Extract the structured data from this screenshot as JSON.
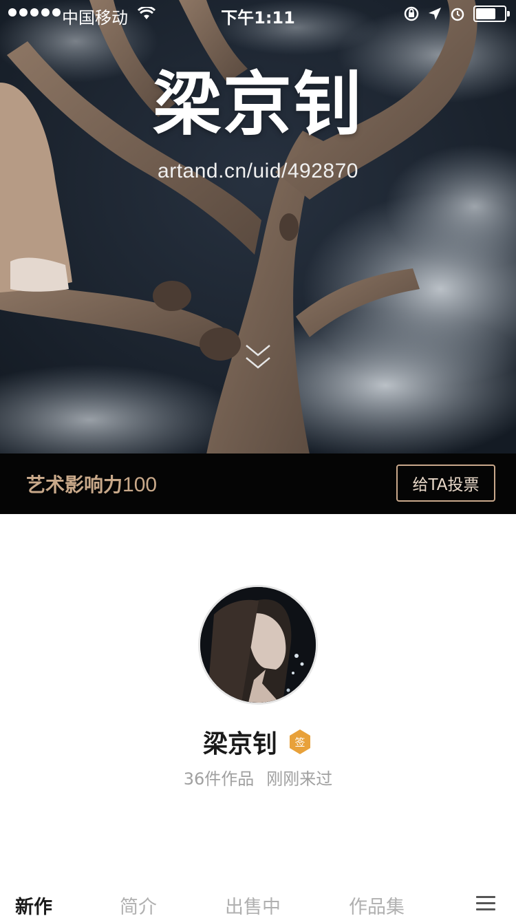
{
  "status_bar": {
    "carrier": "中国移动",
    "time": "下午1:11"
  },
  "hero": {
    "title": "梁京钊",
    "url": "artand.cn/uid/492870"
  },
  "influence": {
    "label": "艺术影响力",
    "value": "100",
    "vote_label": "给TA投票"
  },
  "profile": {
    "name": "梁京钊",
    "badge": "签",
    "works": "36件作品",
    "last_seen": "刚刚来过"
  },
  "tabs": [
    {
      "label": "新作",
      "active": true
    },
    {
      "label": "简介",
      "active": false
    },
    {
      "label": "出售中",
      "active": false
    },
    {
      "label": "作品集",
      "active": false
    }
  ],
  "icons": {
    "menu": "menu-icon",
    "scroll": "chevron-double-down-icon",
    "badge": "signed-badge-icon"
  },
  "colors": {
    "accent_gold": "#c9a98a",
    "badge_orange": "#e8a13a",
    "hero_dark": "#1f2833"
  }
}
